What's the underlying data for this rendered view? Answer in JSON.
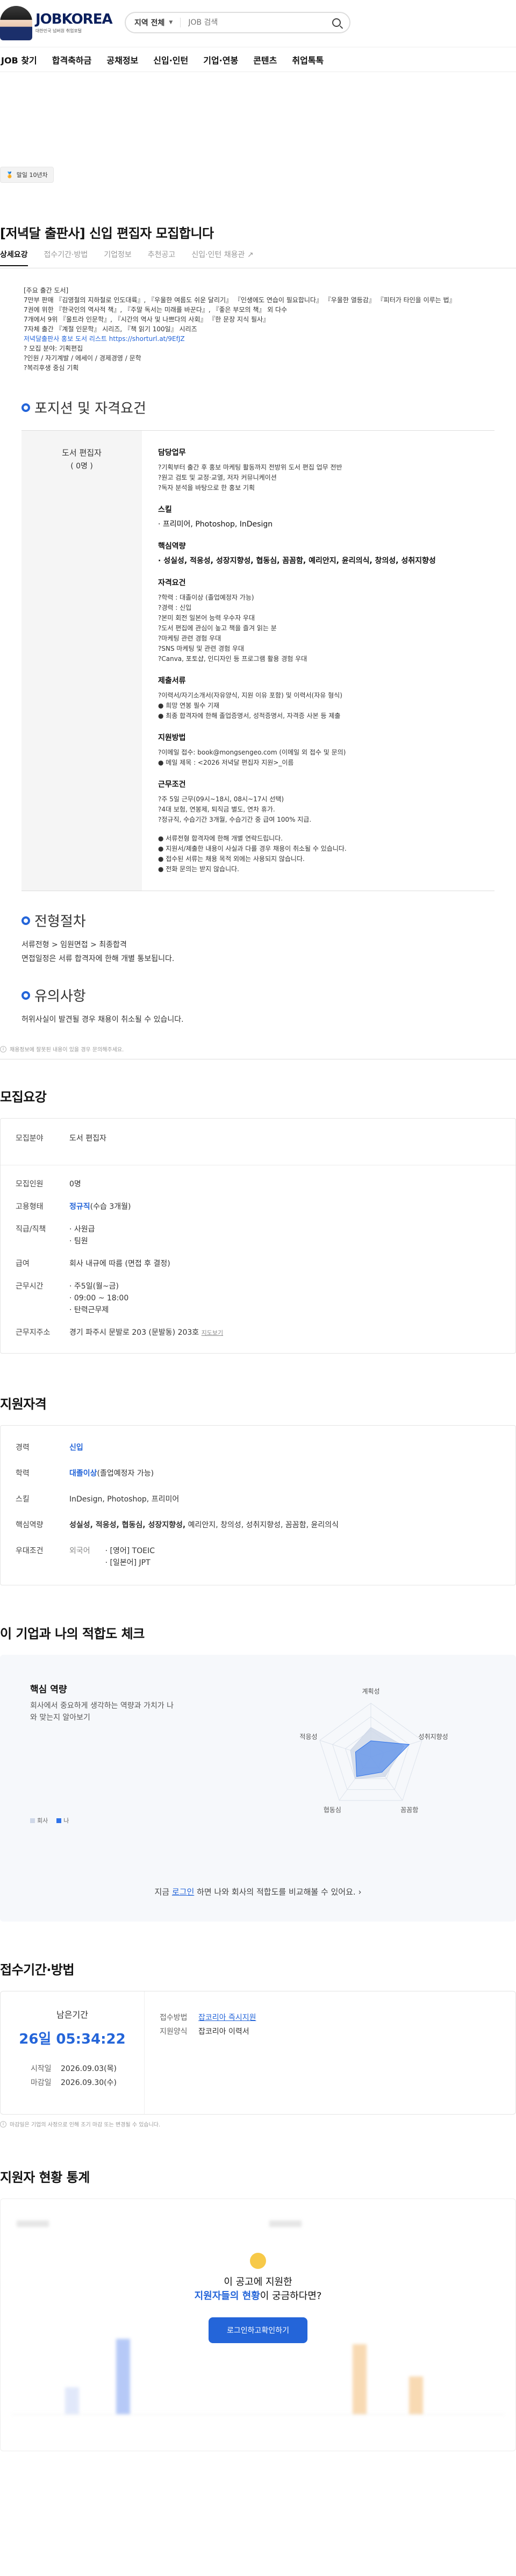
{
  "header": {
    "brand": "JOBKOREA",
    "brand_sub": "대한민국 넘버원 취업포털",
    "search_scope": "지역 전체",
    "search_placeholder": "JOB 검색"
  },
  "gnb": [
    "JOB 찾기",
    "합격축하금",
    "공채정보",
    "신입·인턴",
    "기업·연봉",
    "콘텐츠",
    "취업톡톡"
  ],
  "badge": "말일 10년차",
  "posting": {
    "title": "[저녁달 출판사] 신입 편집자 모집합니다"
  },
  "tabs": [
    "상세요강",
    "접수기간·방법",
    "기업정보",
    "추천공고",
    "신입·인턴 채용관 ↗"
  ],
  "intro_lines": [
    "[주요 출간 도서]",
    "7만부 판매 『김영철의 지하철로 인도대륙』, 『우울한 여름도 쉬운 달리기』 『인생에도 연습이 필요합니다』 『우울한 열등감』 『피터가 타인을 이루는 법』",
    "7권에 위한 『한국인의 역사적 책』, 『주말 독서는 미래를 바꾼다』, 『좋은 부모의 책』 외 다수",
    "7개에서 9위 『울트라 인문학』, 『시간의 역사 및 나쁘다의 사회』 『한 문장 지식 필사』",
    "7자체 출간 『계절 인문학』 시리즈, 『책 읽기 100일』 시리즈",
    "저녁달출판사 홍보 도서 리스트 https://shorturl.at/9EfJZ",
    "? 모집 분야: 기획편집",
    "?인원 / 자기계발 / 에세이 / 경제경영 / 문학",
    "?복리후생 중심 기획"
  ],
  "sections": {
    "position": "포지션 및 자격요건",
    "process": "전형절차",
    "caution": "유의사항"
  },
  "position": {
    "name": "도서 편집자",
    "count": "( 0명 )",
    "duty_title": "담당업무",
    "duty": [
      "?기획부터 출간 후 홍보 마케팅 활동까지 전방위 도서 편집 업무 전반",
      "?원고 검토 및 교정·교열, 저자 커뮤니케이션",
      "?독자 분석을 바탕으로 한 홍보 기획"
    ],
    "skill_title": "스킬",
    "skill": "· 프리미어, Photoshop, InDesign",
    "core_title": "핵심역량",
    "core": "· 성실성, 적응성, 성장지향성, 협동심, 꼼꼼함, 예리안지, 윤리의식, 창의성, 성취지향성",
    "qual_title": "자격요건",
    "qual": [
      "?학력 : 대졸이상 (졸업예정자 가능)",
      "?경력 : 신입",
      "?본미 회전 일본어 능력 우수자 우대",
      "?도서 편집에 관심이 높고 책을 즐겨 읽는 분",
      "?마케팅 관련 경험 우대",
      "?SNS 마케팅 및 관련 경험 우대",
      "?Canva, 포토샵, 인디자인 등 프로그램 활용 경험 우대"
    ],
    "doc_title": "제출서류",
    "doc": [
      "?이력서/자기소개서(자유양식, 지원 이유 포함) 및 이력서(자유 형식)",
      "● 희망 연봉 필수 기재",
      "● 최종 합격자에 한해 졸업증명서, 성적증명서, 자격증 사본 등 제출"
    ],
    "apply_title": "지원방법",
    "apply": [
      "?이메일 접수: book@mongsengeo.com (이메일 외 접수 및 문의)",
      "● 메일 제목 : <2026 저녁달 편집자 지원>_이름"
    ],
    "cond_title": "근무조건",
    "cond": [
      "?주 5일 근무(09시~18시, 08시~17시 선택)",
      "?4대 보험, 연봉제, 퇴직금 별도, 연차 휴가.",
      "?정규직, 수습기간 3개월, 수습기간 중 급여 100% 지급."
    ],
    "notes": [
      "● 서류전형 합격자에 한해 개별 연락드립니다.",
      "● 지원서/제출한 내용이 사실과 다를 경우 채용이 취소될 수 있습니다.",
      "● 접수된 서류는 채용 목적 외에는 사용되지 않습니다.",
      "● 전화 문의는 받지 않습니다."
    ]
  },
  "process": [
    "서류전형 > 임원면접 > 최종합격",
    "면접일정은 서류 합격자에 한해 개별 통보됩니다."
  ],
  "caution": [
    "허위사실이 발견될 경우 채용이 취소될 수 있습니다."
  ],
  "note1": "채용정보에 잘못된 내용이 있을 경우 문의해주세요.",
  "recruit": {
    "title": "모집요강",
    "rows": [
      {
        "k": "모집분야",
        "v": "도서 편집자"
      },
      {
        "k": "모집인원",
        "v": "0명"
      },
      {
        "k": "고용형태",
        "v": "정규직",
        "v2": "(수습 3개월)"
      },
      {
        "k": "직급/직책",
        "v": "· 사원급",
        "v3": "· 팀원"
      },
      {
        "k": "급여",
        "v": "회사 내규에 따름 (면접 후 결정)"
      },
      {
        "k": "근무시간",
        "v": "· 주5일(월~금)",
        "v3": "· 09:00 ~ 18:00",
        "v4": "· 탄력근무제"
      },
      {
        "k": "근무지주소",
        "v": "경기 파주시 문발로 203 (문발동) 203호",
        "v2": "지도보기"
      }
    ]
  },
  "qualify": {
    "title": "지원자격",
    "rows": [
      {
        "k": "경력",
        "v": "신입"
      },
      {
        "k": "학력",
        "v": "대졸이상",
        "v2": "(졸업예정자 가능)"
      },
      {
        "k": "스킬",
        "v": "InDesign, Photoshop, 프리미어"
      },
      {
        "k": "핵심역량",
        "v": "성실성, 적응성, 협동심, 성장지향성,",
        "v2": " 예리안지, 창의성, 성취지향성, 꼼꼼함, 윤리의식"
      },
      {
        "k": "우대조건",
        "v": "외국어",
        "v3": "· [영어] TOEIC",
        "v4": "· [일본어] JPT"
      }
    ]
  },
  "fit": {
    "title": "이 기업과 나의 적합도 체크",
    "label": "핵심 역량",
    "desc": "회사에서 중요하게 생각하는 역량과 가치가 나와 맞는지 알아보기",
    "legend_company": "회사",
    "legend_me": "나",
    "footer_pre": "지금 ",
    "footer_link": "로그인",
    "footer_post": " 하면 나와 회사의 적합도를 비교해볼 수 있어요. ›"
  },
  "chart_data": {
    "type": "radar",
    "axes": [
      "계획성",
      "성취지향성",
      "꼼꼼함",
      "협동심",
      "적응성"
    ],
    "series": [
      {
        "name": "회사",
        "values": [
          0.55,
          0.65,
          0.45,
          0.5,
          0.4
        ]
      },
      {
        "name": "나",
        "values": [
          0.3,
          0.75,
          0.35,
          0.45,
          0.3
        ]
      }
    ],
    "colors": [
      "#cfd8e8",
      "#2f73ea"
    ]
  },
  "period": {
    "title": "접수기간·방법",
    "remain_label": "남은기간",
    "remain": "26일 05:34:22",
    "start_k": "시작일",
    "start": "2026.09.03(목)",
    "end_k": "마감일",
    "end": "2026.09.30(수)",
    "method_k": "접수방법",
    "method": "잡코리아 즉시지원",
    "form_k": "지원양식",
    "form": "잡코리아 이력서",
    "note": "마감일은 기업의 사정으로 인해 조기 마감 또는 변경될 수 있습니다."
  },
  "stats": {
    "title": "지원자 현황 통계",
    "q1": "이 공고에 지원한",
    "q2_blue": "지원자들의 현황",
    "q2_post": "이 궁금하다면?",
    "btn": "로그인하고확인하기"
  }
}
